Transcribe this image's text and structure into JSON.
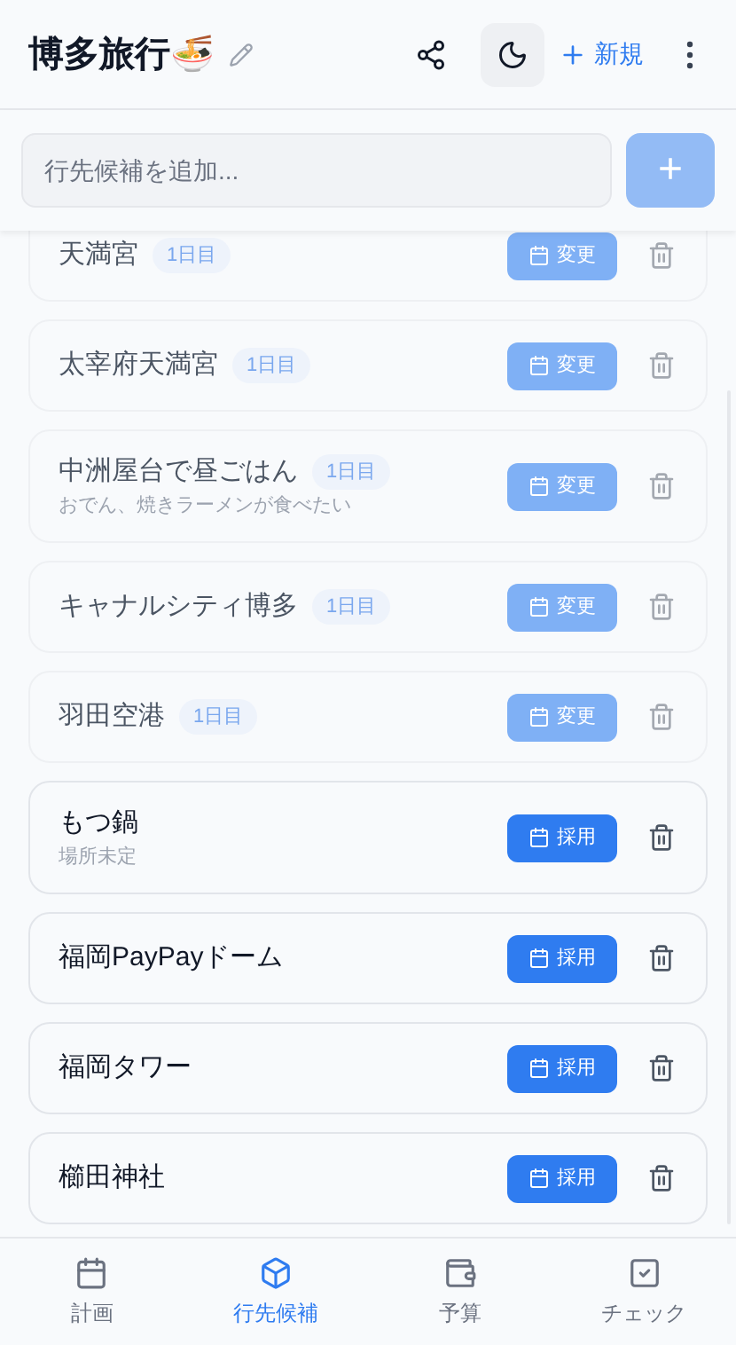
{
  "header": {
    "title": "博多旅行🍜",
    "new_button": "新規"
  },
  "add_field": {
    "placeholder": "行先候補を追加...",
    "button": "+"
  },
  "items": [
    {
      "name": "天満宮",
      "badge": "1日目",
      "adopted": true,
      "action": "変更"
    },
    {
      "name": "太宰府天満宮",
      "badge": "1日目",
      "adopted": true,
      "action": "変更"
    },
    {
      "name": "中洲屋台で昼ごはん",
      "badge": "1日目",
      "note": "おでん、焼きラーメンが食べたい",
      "adopted": true,
      "action": "変更"
    },
    {
      "name": "キャナルシティ博多",
      "badge": "1日目",
      "adopted": true,
      "action": "変更"
    },
    {
      "name": "羽田空港",
      "badge": "1日目",
      "adopted": true,
      "action": "変更"
    },
    {
      "name": "もつ鍋",
      "note": "場所未定",
      "adopted": false,
      "action": "採用"
    },
    {
      "name": "福岡PayPayドーム",
      "adopted": false,
      "action": "採用"
    },
    {
      "name": "福岡タワー",
      "adopted": false,
      "action": "採用"
    },
    {
      "name": "櫛田神社",
      "adopted": false,
      "action": "採用"
    }
  ],
  "nav": [
    {
      "label": "計画",
      "selected": false
    },
    {
      "label": "行先候補",
      "selected": true
    },
    {
      "label": "予算",
      "selected": false
    },
    {
      "label": "チェック",
      "selected": false
    }
  ]
}
